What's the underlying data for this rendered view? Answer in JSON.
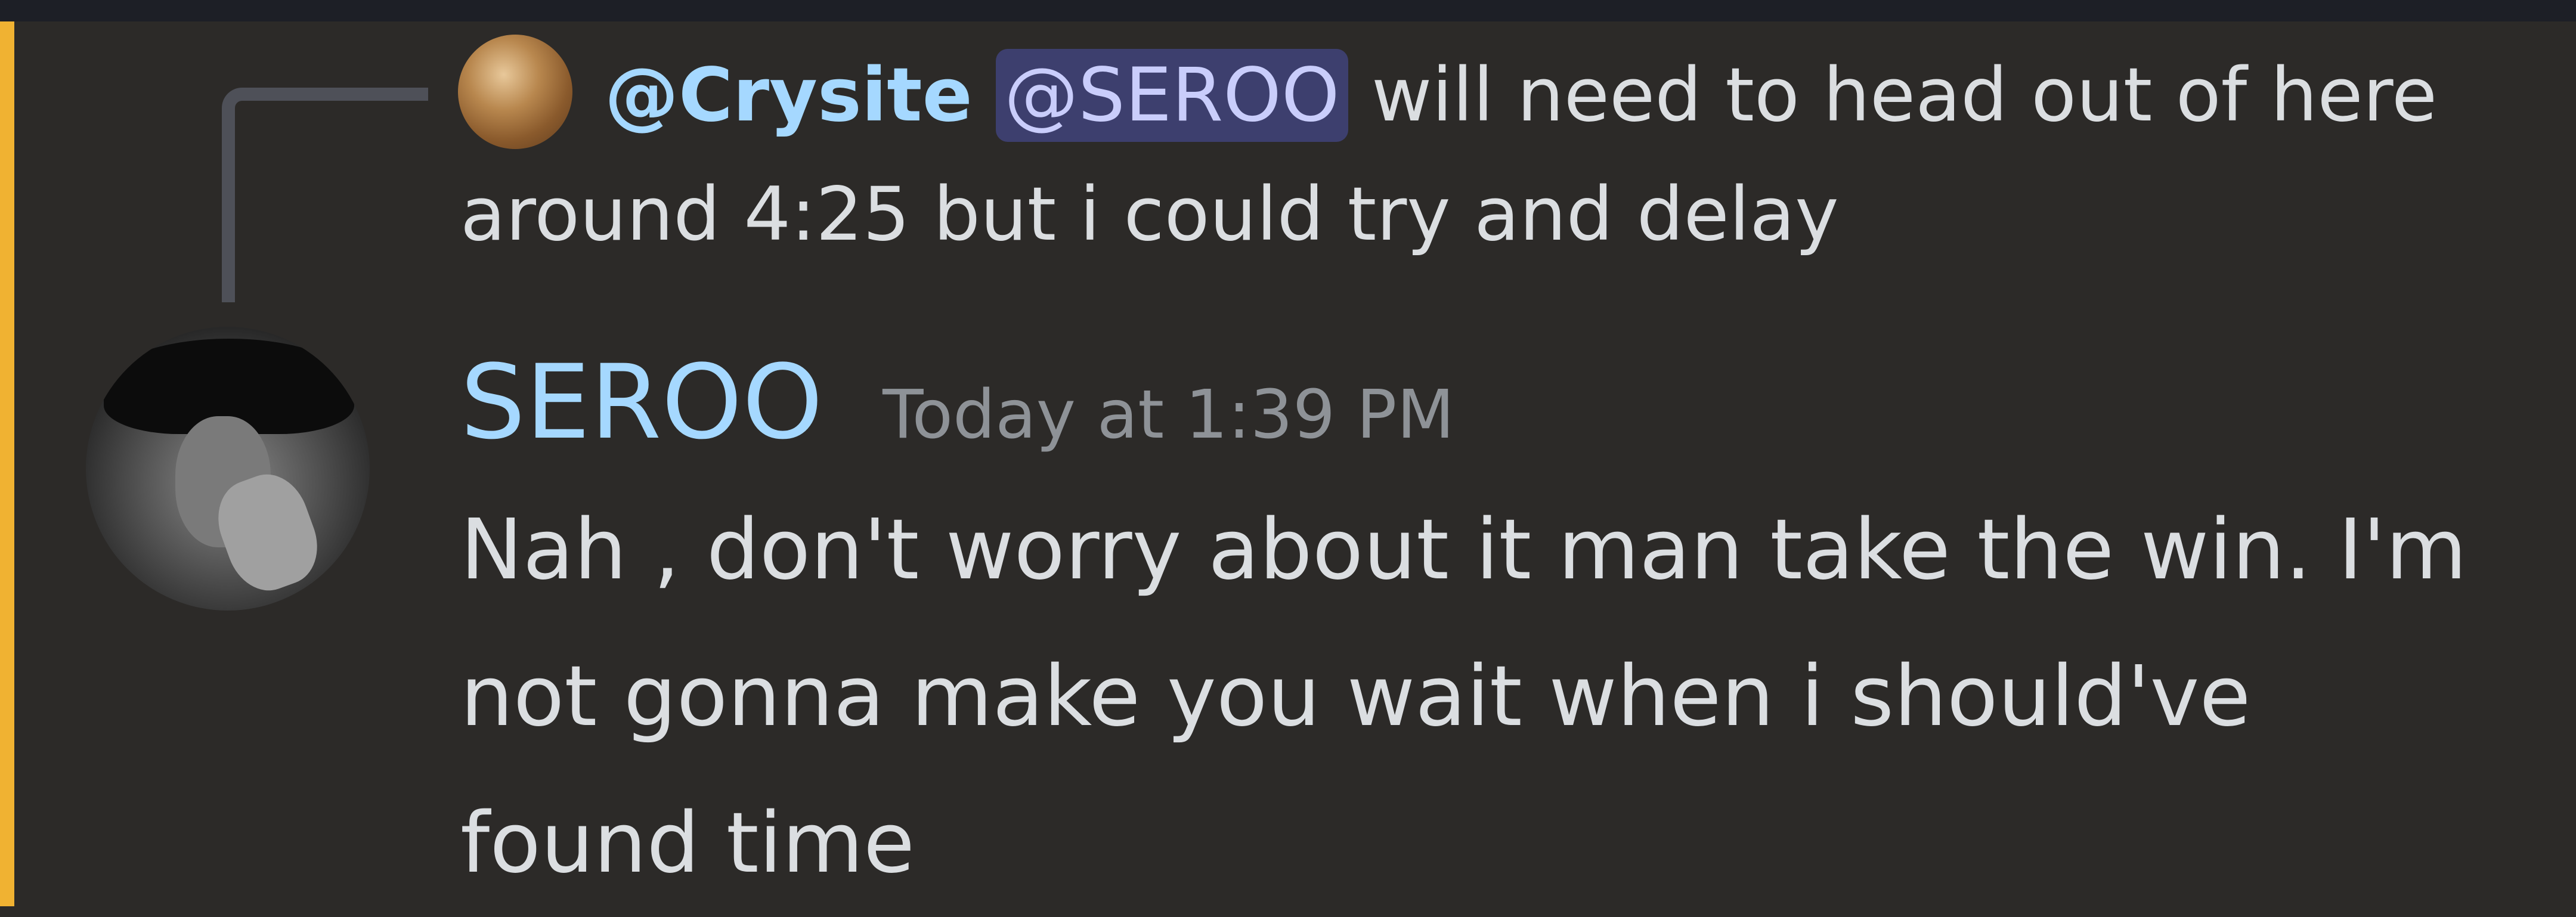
{
  "colors": {
    "background": "#2c2a28",
    "mention_highlight_bar": "#f0b232",
    "username": "#a5d8ff",
    "mention_pill_bg": "#3d3f6e",
    "mention_pill_text": "#c9cdfb",
    "message_text": "#dbdee1",
    "timestamp": "#8e9297"
  },
  "reply": {
    "author": "@Crysite",
    "mention": "@SEROO",
    "text": "will need to head out of here around 4:25 but i could try and delay"
  },
  "message": {
    "author": "SEROO",
    "timestamp": "Today at 1:39 PM",
    "body": "Nah , don't worry about it man take the win. I'm not gonna make you wait when i should've found time"
  }
}
